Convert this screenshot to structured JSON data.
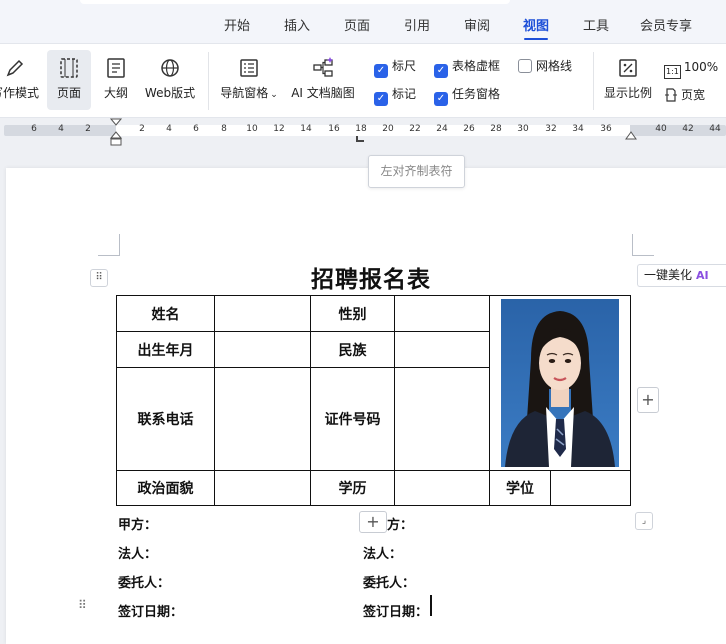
{
  "tabs": [
    {
      "label": "开始",
      "active": false
    },
    {
      "label": "插入",
      "active": false
    },
    {
      "label": "页面",
      "active": false
    },
    {
      "label": "引用",
      "active": false
    },
    {
      "label": "审阅",
      "active": false
    },
    {
      "label": "视图",
      "active": true
    },
    {
      "label": "工具",
      "active": false
    },
    {
      "label": "会员专享",
      "active": false
    }
  ],
  "ribbon": {
    "views": [
      {
        "label": "写作模式",
        "icon": "pen-icon"
      },
      {
        "label": "页面",
        "icon": "page-view-icon",
        "selected": true
      },
      {
        "label": "大纲",
        "icon": "outline-icon"
      },
      {
        "label": "Web版式",
        "icon": "globe-icon"
      }
    ],
    "nav_pane": "导航窗格",
    "ai_map": "AI 文档脑图",
    "checks": [
      {
        "label": "标尺",
        "checked": true
      },
      {
        "label": "表格虚框",
        "checked": true
      },
      {
        "label": "网格线",
        "checked": false
      },
      {
        "label": "标记",
        "checked": true
      },
      {
        "label": "任务窗格",
        "checked": true
      }
    ],
    "zoom_ratio": "显示比例",
    "zoom_100": "100%",
    "zoom_100_icon_text": "1:1",
    "page_width": "页宽"
  },
  "ruler": {
    "ticks": [
      "6",
      "4",
      "2",
      "2",
      "4",
      "6",
      "8",
      "10",
      "12",
      "14",
      "16",
      "18",
      "20",
      "22",
      "24",
      "26",
      "28",
      "30",
      "32",
      "34",
      "36",
      "40",
      "42",
      "44"
    ]
  },
  "tooltip": "左对齐制表符",
  "doc": {
    "title": "招聘报名表",
    "beautify": "一键美化",
    "beautify_ai": "AI",
    "table": {
      "name": "姓名",
      "gender": "性别",
      "birth": "出生年月",
      "ethnicity": "民族",
      "phone": "联系电话",
      "id_no": "证件号码",
      "political": "政治面貌",
      "education": "学历",
      "degree": "学位"
    },
    "signature": {
      "party_a": "甲方：",
      "party_b_partial": "方：",
      "legal_a": "法人：",
      "legal_b": "法人：",
      "agent_a": "委托人：",
      "agent_b": "委托人：",
      "date_a": "签订日期：",
      "date_b": "签订日期："
    }
  },
  "colors": {
    "accent": "#1d4fd8",
    "checkbox": "#2a62e8",
    "photo_bg": "#2f6fb5"
  }
}
